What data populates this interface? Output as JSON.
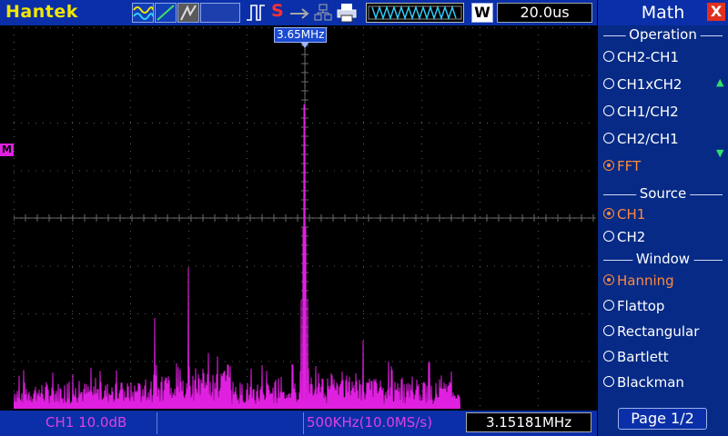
{
  "brand": "Hantek",
  "toolbar": {
    "trigger_icon": "rising-edge-icon",
    "stop_label": "S",
    "w_label": "W",
    "timebase": "20.0us"
  },
  "cursor": {
    "label": "3.65MHz"
  },
  "math_marker": "M",
  "status": {
    "ch_scale": "CH1 10.0dB",
    "sample": "500KHz(10.0MS/s)",
    "frequency": "3.15181MHz"
  },
  "panel": {
    "title": "Math",
    "close": "X",
    "operation": {
      "heading": "Operation",
      "options": [
        {
          "label": "CH2-CH1",
          "selected": false
        },
        {
          "label": "CH1xCH2",
          "selected": false
        },
        {
          "label": "CH1/CH2",
          "selected": false
        },
        {
          "label": "CH2/CH1",
          "selected": false
        },
        {
          "label": "FFT",
          "selected": true
        }
      ]
    },
    "source": {
      "heading": "Source",
      "options": [
        {
          "label": "CH1",
          "selected": true
        },
        {
          "label": "CH2",
          "selected": false
        }
      ]
    },
    "window": {
      "heading": "Window",
      "options": [
        {
          "label": "Hanning",
          "selected": true
        },
        {
          "label": "Flattop",
          "selected": false
        },
        {
          "label": "Rectangular",
          "selected": false
        },
        {
          "label": "Bartlett",
          "selected": false
        },
        {
          "label": "Blackman",
          "selected": false
        }
      ]
    },
    "page": "Page 1/2"
  },
  "colors": {
    "trace": "#e020e0",
    "accent": "#ff8a3c",
    "panel": "#062a86",
    "bar": "#0a2fa8"
  }
}
